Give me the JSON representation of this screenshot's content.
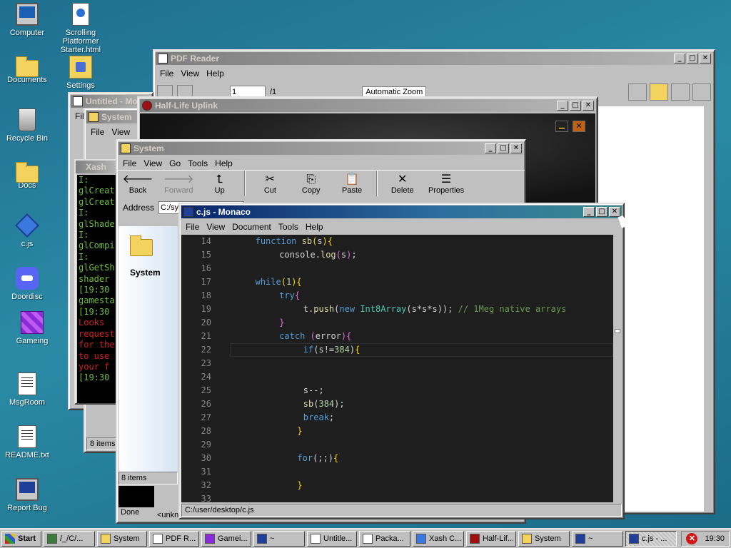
{
  "desktop_icons": [
    {
      "label": "Computer",
      "icon": "computer-icon"
    },
    {
      "label": "Documents",
      "icon": "folder-icon"
    },
    {
      "label": "Recycle Bin",
      "icon": "recycle-bin-icon"
    },
    {
      "label": "Docs",
      "icon": "folder-icon"
    },
    {
      "label": "c.js",
      "icon": "diamond-icon"
    },
    {
      "label": "Doordisc",
      "icon": "discord-icon"
    },
    {
      "label": "Gameing",
      "icon": "cube-icon"
    },
    {
      "label": "MsgRoom",
      "icon": "msgroom-icon"
    },
    {
      "label": "README.txt",
      "icon": "text-file-icon"
    },
    {
      "label": "Report Bug",
      "icon": "report-bug-icon"
    },
    {
      "label": "Scrolling Platformer Starter.html",
      "icon": "html-file-icon"
    },
    {
      "label": "Settings",
      "icon": "settings-icon"
    }
  ],
  "pdf_reader": {
    "title": "PDF Reader",
    "menu": [
      "File",
      "View",
      "Help"
    ],
    "page_number": "1",
    "page_total": "/1",
    "zoom": "Automatic Zoom"
  },
  "untitled_window": {
    "title": "Untitled - Mo",
    "menu_first": "File"
  },
  "system_back": {
    "title": "System",
    "menu": [
      "File",
      "View"
    ],
    "status": "8 items"
  },
  "xash": {
    "title": "Xash",
    "lines": [
      {
        "text": "I:",
        "color": "#6fbf3a"
      },
      {
        "text": "glCreat",
        "color": "#6fbf3a"
      },
      {
        "text": "glCreat",
        "color": "#6fbf3a"
      },
      {
        "text": "I:",
        "color": "#6fbf3a"
      },
      {
        "text": "glShade",
        "color": "#6fbf3a"
      },
      {
        "text": "I:",
        "color": "#6fbf3a"
      },
      {
        "text": "glCompi",
        "color": "#6fbf3a"
      },
      {
        "text": "I:",
        "color": "#6fbf3a"
      },
      {
        "text": "glGetSh",
        "color": "#6fbf3a"
      },
      {
        "text": "shader",
        "color": "#6fbf3a"
      },
      {
        "text": "[19:30",
        "color": "#6fbf3a"
      },
      {
        "text": "gamesta",
        "color": "#6fbf3a"
      },
      {
        "text": "[19:30",
        "color": "#6fbf3a"
      },
      {
        "text": "Looks",
        "color": "#d02020"
      },
      {
        "text": "request",
        "color": "#d02020"
      },
      {
        "text": "for the",
        "color": "#d02020"
      },
      {
        "text": "to use",
        "color": "#d02020"
      },
      {
        "text": "your f",
        "color": "#d02020"
      },
      {
        "text": "[19:30",
        "color": "#6fbf3a"
      }
    ]
  },
  "halflife": {
    "title": "Half-Life Uplink"
  },
  "system_front": {
    "title": "System",
    "menu": [
      "File",
      "View",
      "Go",
      "Tools",
      "Help"
    ],
    "toolbar": [
      {
        "label": "Back",
        "glyph": "🡐",
        "enabled": true
      },
      {
        "label": "Forward",
        "glyph": "🡒",
        "enabled": false
      },
      {
        "label": "Up",
        "glyph": "⮤",
        "enabled": true
      },
      {
        "label": "Cut",
        "glyph": "✂",
        "enabled": true
      },
      {
        "label": "Copy",
        "glyph": "⎘",
        "enabled": true
      },
      {
        "label": "Paste",
        "glyph": "📋",
        "enabled": true
      },
      {
        "label": "Delete",
        "glyph": "✕",
        "enabled": true
      },
      {
        "label": "Properties",
        "glyph": "☰",
        "enabled": true
      }
    ],
    "address_label": "Address",
    "address_value": "C:/sys",
    "folder_name": "System",
    "status": "8 items",
    "done": "Done",
    "unknown": "<unknown"
  },
  "monaco": {
    "title": "c.js - Monaco",
    "menu": [
      "File",
      "View",
      "Document",
      "Tools",
      "Help"
    ],
    "status_path": "C:/user/desktop/c.js",
    "current_line": "22",
    "lines": [
      {
        "n": "14",
        "html": "<span class='kw'>function</span> <span class='fn'>sb</span><span class='ye'>(</span>s<span class='ye'>)</span><span class='ye'>{</span>",
        "indent": 4
      },
      {
        "n": "15",
        "html": "console.<span class='fn'>log</span><span class='br'>(</span>s<span class='br'>)</span>;",
        "indent": 8
      },
      {
        "n": "16",
        "html": "",
        "indent": 0
      },
      {
        "n": "17",
        "html": "<span class='kw'>while</span><span class='ye'>(</span><span class='num'>1</span><span class='ye'>)</span><span class='ye'>{</span>",
        "indent": 4
      },
      {
        "n": "18",
        "html": "<span class='kw'>try</span><span class='br'>{</span>",
        "indent": 8
      },
      {
        "n": "19",
        "html": "t.<span class='fn'>push</span>(<span class='kw'>new</span> <span class='ty'>Int8Array</span>(s*s*s)); <span class='cm'>// 1Meg native arrays</span>",
        "indent": 12
      },
      {
        "n": "20",
        "html": "<span class='br'>}</span>",
        "indent": 8
      },
      {
        "n": "21",
        "html": "<span class='kw'>catch</span> <span class='br'>(</span>error<span class='br'>)</span><span class='br'>{</span>",
        "indent": 8
      },
      {
        "n": "22",
        "html": "<span class='kw'>if</span>(s!=<span class='num'>384</span>)<span class='ye'>{</span>",
        "indent": 12
      },
      {
        "n": "23",
        "html": "",
        "indent": 0
      },
      {
        "n": "24",
        "html": "",
        "indent": 0
      },
      {
        "n": "25",
        "html": "s--;",
        "indent": 12
      },
      {
        "n": "26",
        "html": "<span class='fn'>sb</span>(<span class='num'>384</span>);",
        "indent": 12
      },
      {
        "n": "27",
        "html": "<span class='kw'>break</span>;",
        "indent": 12
      },
      {
        "n": "28",
        "html": "<span class='ye'>}</span>",
        "indent": 11
      },
      {
        "n": "29",
        "html": "",
        "indent": 0
      },
      {
        "n": "30",
        "html": "<span class='kw'>for</span>(;;)<span class='ye'>{</span>",
        "indent": 11
      },
      {
        "n": "31",
        "html": "",
        "indent": 0
      },
      {
        "n": "32",
        "html": "<span class='ye'>}</span>",
        "indent": 11
      },
      {
        "n": "33",
        "html": "",
        "indent": 0
      }
    ]
  },
  "taskbar": {
    "start": "Start",
    "tasks": [
      {
        "label": "/_/C/...",
        "icon": "globe-icon",
        "color": "#3a7a3a"
      },
      {
        "label": "System",
        "icon": "folder-icon",
        "color": "#f3d35e"
      },
      {
        "label": "PDF R...",
        "icon": "pdf-icon",
        "color": "#ffffff"
      },
      {
        "label": "Gamei...",
        "icon": "cube-icon",
        "color": "#8a2bd8"
      },
      {
        "label": "~",
        "icon": "terminal-icon",
        "color": "#203f9a"
      },
      {
        "label": "Untitle...",
        "icon": "notepad-icon",
        "color": "#ffffff"
      },
      {
        "label": "Packa...",
        "icon": "package-icon",
        "color": "#ffffff"
      },
      {
        "label": "Xash C...",
        "icon": "diamond-icon",
        "color": "#3a78e0"
      },
      {
        "label": "Half-Lif...",
        "icon": "halflife-icon",
        "color": "#a01010"
      },
      {
        "label": "System",
        "icon": "folder-icon",
        "color": "#f3d35e"
      },
      {
        "label": "~",
        "icon": "terminal-icon",
        "color": "#203f9a"
      },
      {
        "label": "c.js - ...",
        "icon": "editor-icon",
        "color": "#203f9a"
      }
    ],
    "clock": "19:30"
  }
}
